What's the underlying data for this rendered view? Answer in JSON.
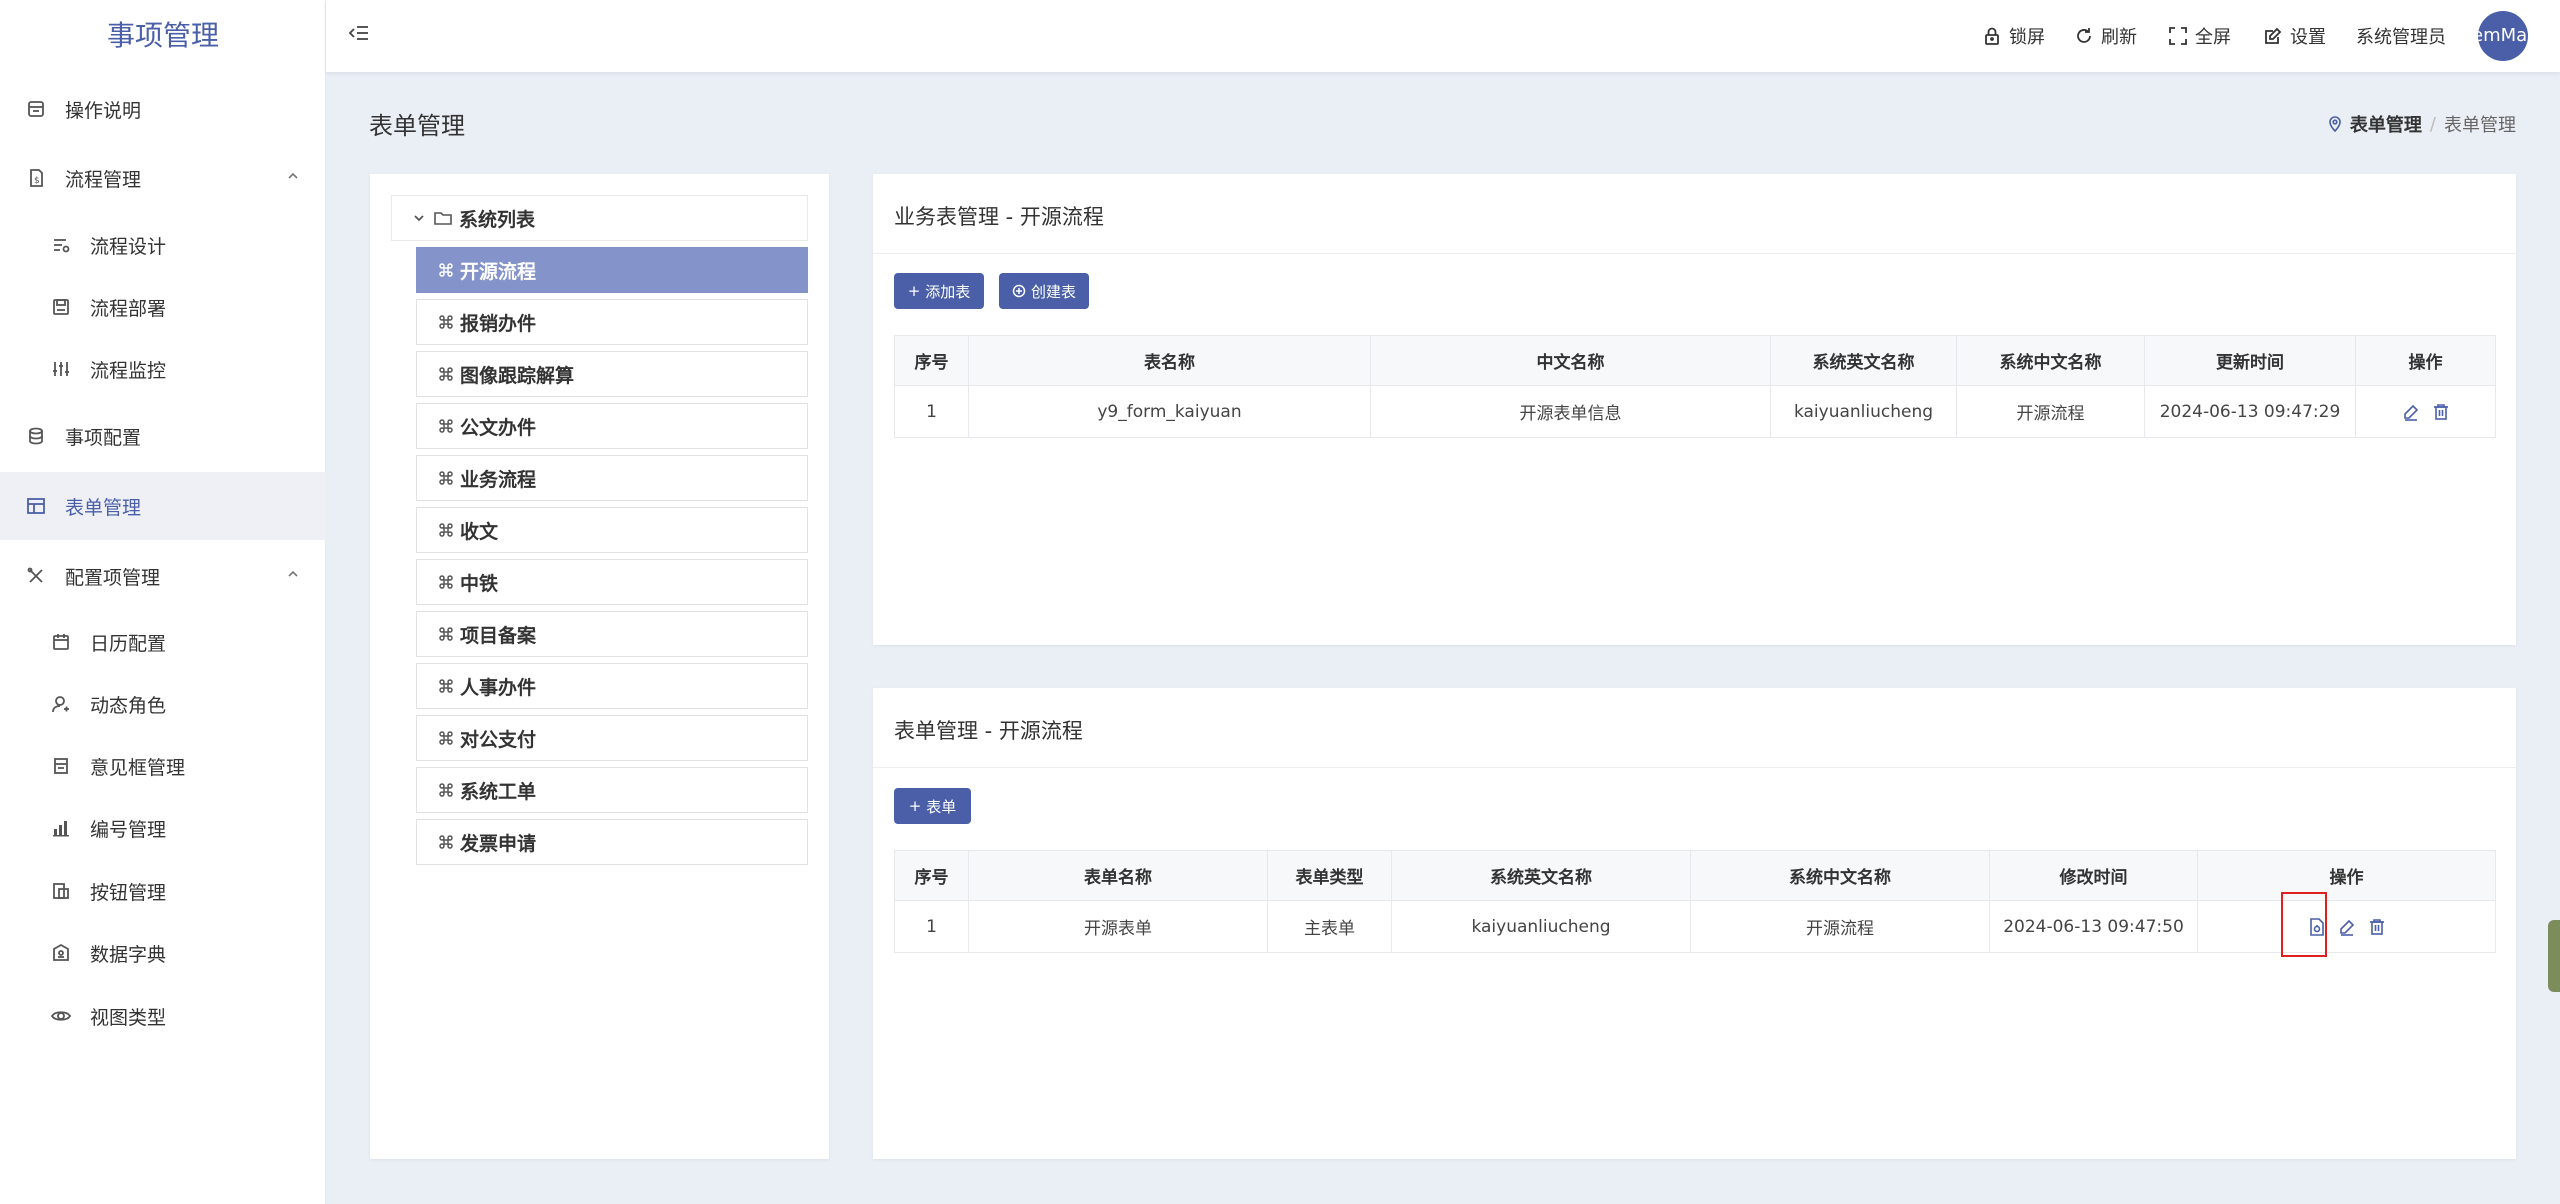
{
  "app": {
    "title": "事项管理"
  },
  "header": {
    "lock_label": "锁屏",
    "refresh_label": "刷新",
    "fullscreen_label": "全屏",
    "settings_label": "设置",
    "user_name": "系统管理员",
    "avatar_text": "emMan"
  },
  "sidebar": {
    "items": [
      {
        "label": "操作说明",
        "icon": "manual-icon"
      },
      {
        "label": "流程管理",
        "icon": "process-icon"
      },
      {
        "label": "流程设计",
        "icon": "design-icon"
      },
      {
        "label": "流程部署",
        "icon": "deploy-icon"
      },
      {
        "label": "流程监控",
        "icon": "monitor-icon"
      },
      {
        "label": "事项配置",
        "icon": "database-icon"
      },
      {
        "label": "表单管理",
        "icon": "table-icon"
      },
      {
        "label": "配置项管理",
        "icon": "tools-icon"
      },
      {
        "label": "日历配置",
        "icon": "calendar-icon"
      },
      {
        "label": "动态角色",
        "icon": "user-icon"
      },
      {
        "label": "意见框管理",
        "icon": "comment-box-icon"
      },
      {
        "label": "编号管理",
        "icon": "bar-chart-icon"
      },
      {
        "label": "按钮管理",
        "icon": "button-icon"
      },
      {
        "label": "数据字典",
        "icon": "dictionary-icon"
      },
      {
        "label": "视图类型",
        "icon": "eye-icon"
      }
    ]
  },
  "page": {
    "title": "表单管理",
    "breadcrumb": [
      "表单管理",
      "表单管理"
    ]
  },
  "tree": {
    "root_label": "系统列表",
    "nodes": [
      "开源流程",
      "报销办件",
      "图像跟踪解算",
      "公文办件",
      "业务流程",
      "收文",
      "中铁",
      "项目备案",
      "人事办件",
      "对公支付",
      "系统工单",
      "发票申请"
    ]
  },
  "biz_table": {
    "title": "业务表管理 - 开源流程",
    "add_button": "添加表",
    "create_button": "创建表",
    "columns": [
      "序号",
      "表名称",
      "中文名称",
      "系统英文名称",
      "系统中文名称",
      "更新时间",
      "操作"
    ],
    "rows": [
      [
        "1",
        "y9_form_kaiyuan",
        "开源表单信息",
        "kaiyuanliucheng",
        "开源流程",
        "2024-06-13 09:47:29"
      ]
    ]
  },
  "form_table": {
    "title": "表单管理 - 开源流程",
    "add_button": "表单",
    "columns": [
      "序号",
      "表单名称",
      "表单类型",
      "系统英文名称",
      "系统中文名称",
      "修改时间",
      "操作"
    ],
    "rows": [
      [
        "1",
        "开源表单",
        "主表单",
        "kaiyuanliucheng",
        "开源流程",
        "2024-06-13 09:47:50"
      ]
    ]
  },
  "colors": {
    "accent": "#4a5fa8",
    "tree_active": "#8493c9",
    "highlight": "#e02020"
  }
}
